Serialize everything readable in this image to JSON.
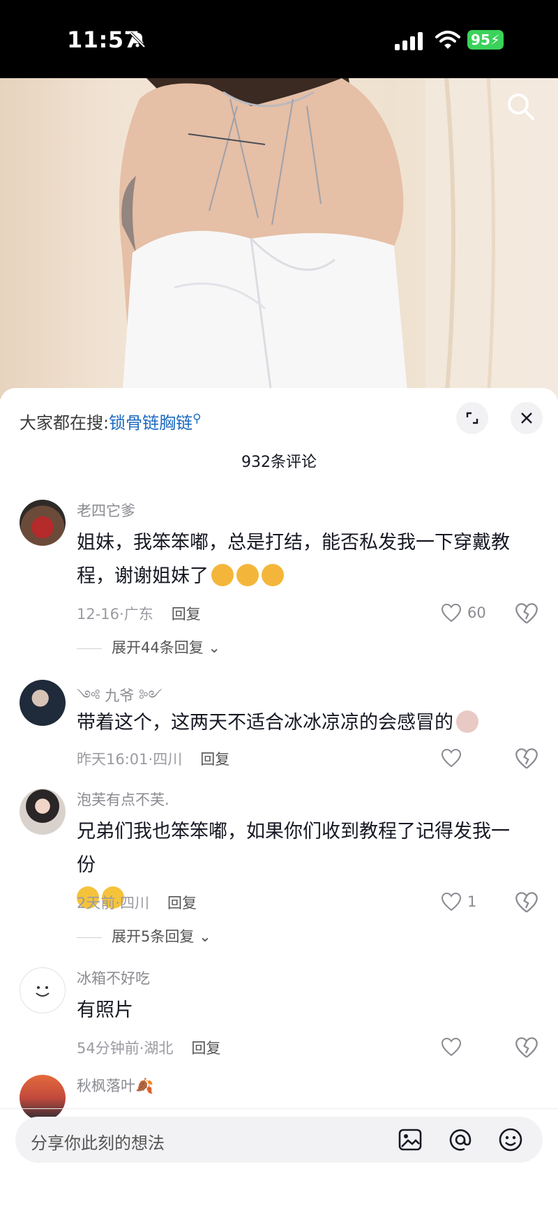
{
  "status_bar": {
    "time": "11:57",
    "battery": "95"
  },
  "search_hint": {
    "prefix": "大家都在搜:",
    "keyword": "锁骨链胸链"
  },
  "comments_header": {
    "count_label": "932条评论"
  },
  "comments": [
    {
      "user": "老四它爹",
      "text": "姐妹，我笨笨嘟，总是打结，能否私发我一下穿戴教程，谢谢姐妹了",
      "date": "12-16·广东",
      "reply_label": "回复",
      "likes": "60",
      "expand": "展开44条回复"
    },
    {
      "user": "九爷",
      "text": "带着这个，这两天不适合冰冰凉凉的会感冒的",
      "date": "昨天16:01·四川",
      "reply_label": "回复",
      "likes": ""
    },
    {
      "user": "泡芙有点不芙.",
      "text": "兄弟们我也笨笨嘟，如果你们收到教程了记得发我一份",
      "date": "2天前·四川",
      "reply_label": "回复",
      "likes": "1",
      "expand": "展开5条回复"
    },
    {
      "user": "冰箱不好吃",
      "text": "有照片",
      "date": "54分钟前·湖北",
      "reply_label": "回复",
      "likes": ""
    },
    {
      "user": "秋枫落叶"
    }
  ],
  "input": {
    "placeholder": "分享你此刻的想法"
  },
  "icons": {
    "search": "search-icon",
    "expand": "expand-icon",
    "close": "close-icon",
    "like": "heart-icon",
    "dislike": "broken-heart-icon",
    "image": "image-icon",
    "mention": "at-icon",
    "emoji": "emoji-icon"
  },
  "colors": {
    "keyword": "#1d6bc1",
    "battery": "#3ad25a",
    "muted": "#8a8b91"
  }
}
